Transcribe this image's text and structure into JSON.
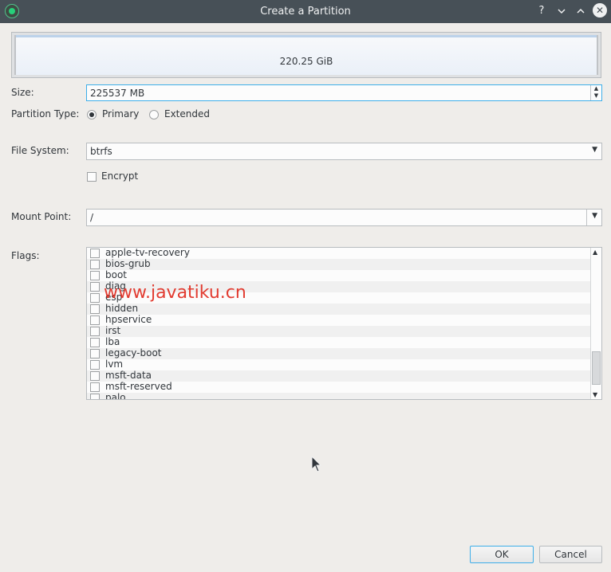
{
  "window": {
    "title": "Create a Partition",
    "help_symbol": "?",
    "minimize_symbol": "⌄",
    "maximize_symbol": "⌃",
    "close_symbol": "✕"
  },
  "partition_bar": {
    "size_label": "220.25 GiB"
  },
  "size": {
    "label": "Size:",
    "value": "225537 MB"
  },
  "partition_type": {
    "label": "Partition Type:",
    "options": [
      "Primary",
      "Extended"
    ],
    "selected": "Primary"
  },
  "file_system": {
    "label": "File System:",
    "value": "btrfs"
  },
  "encrypt": {
    "label": "Encrypt",
    "checked": false
  },
  "mount_point": {
    "label": "Mount Point:",
    "value": "/"
  },
  "flags": {
    "label": "Flags:",
    "items": [
      "apple-tv-recovery",
      "bios-grub",
      "boot",
      "diag",
      "esp",
      "hidden",
      "hpservice",
      "irst",
      "lba",
      "legacy-boot",
      "lvm",
      "msft-data",
      "msft-reserved",
      "palo"
    ]
  },
  "watermark": "www.javatiku.cn",
  "buttons": {
    "ok": "OK",
    "cancel": "Cancel"
  },
  "icons": {
    "app": "partition-manager-icon",
    "cursor": "mouse-pointer-icon"
  }
}
